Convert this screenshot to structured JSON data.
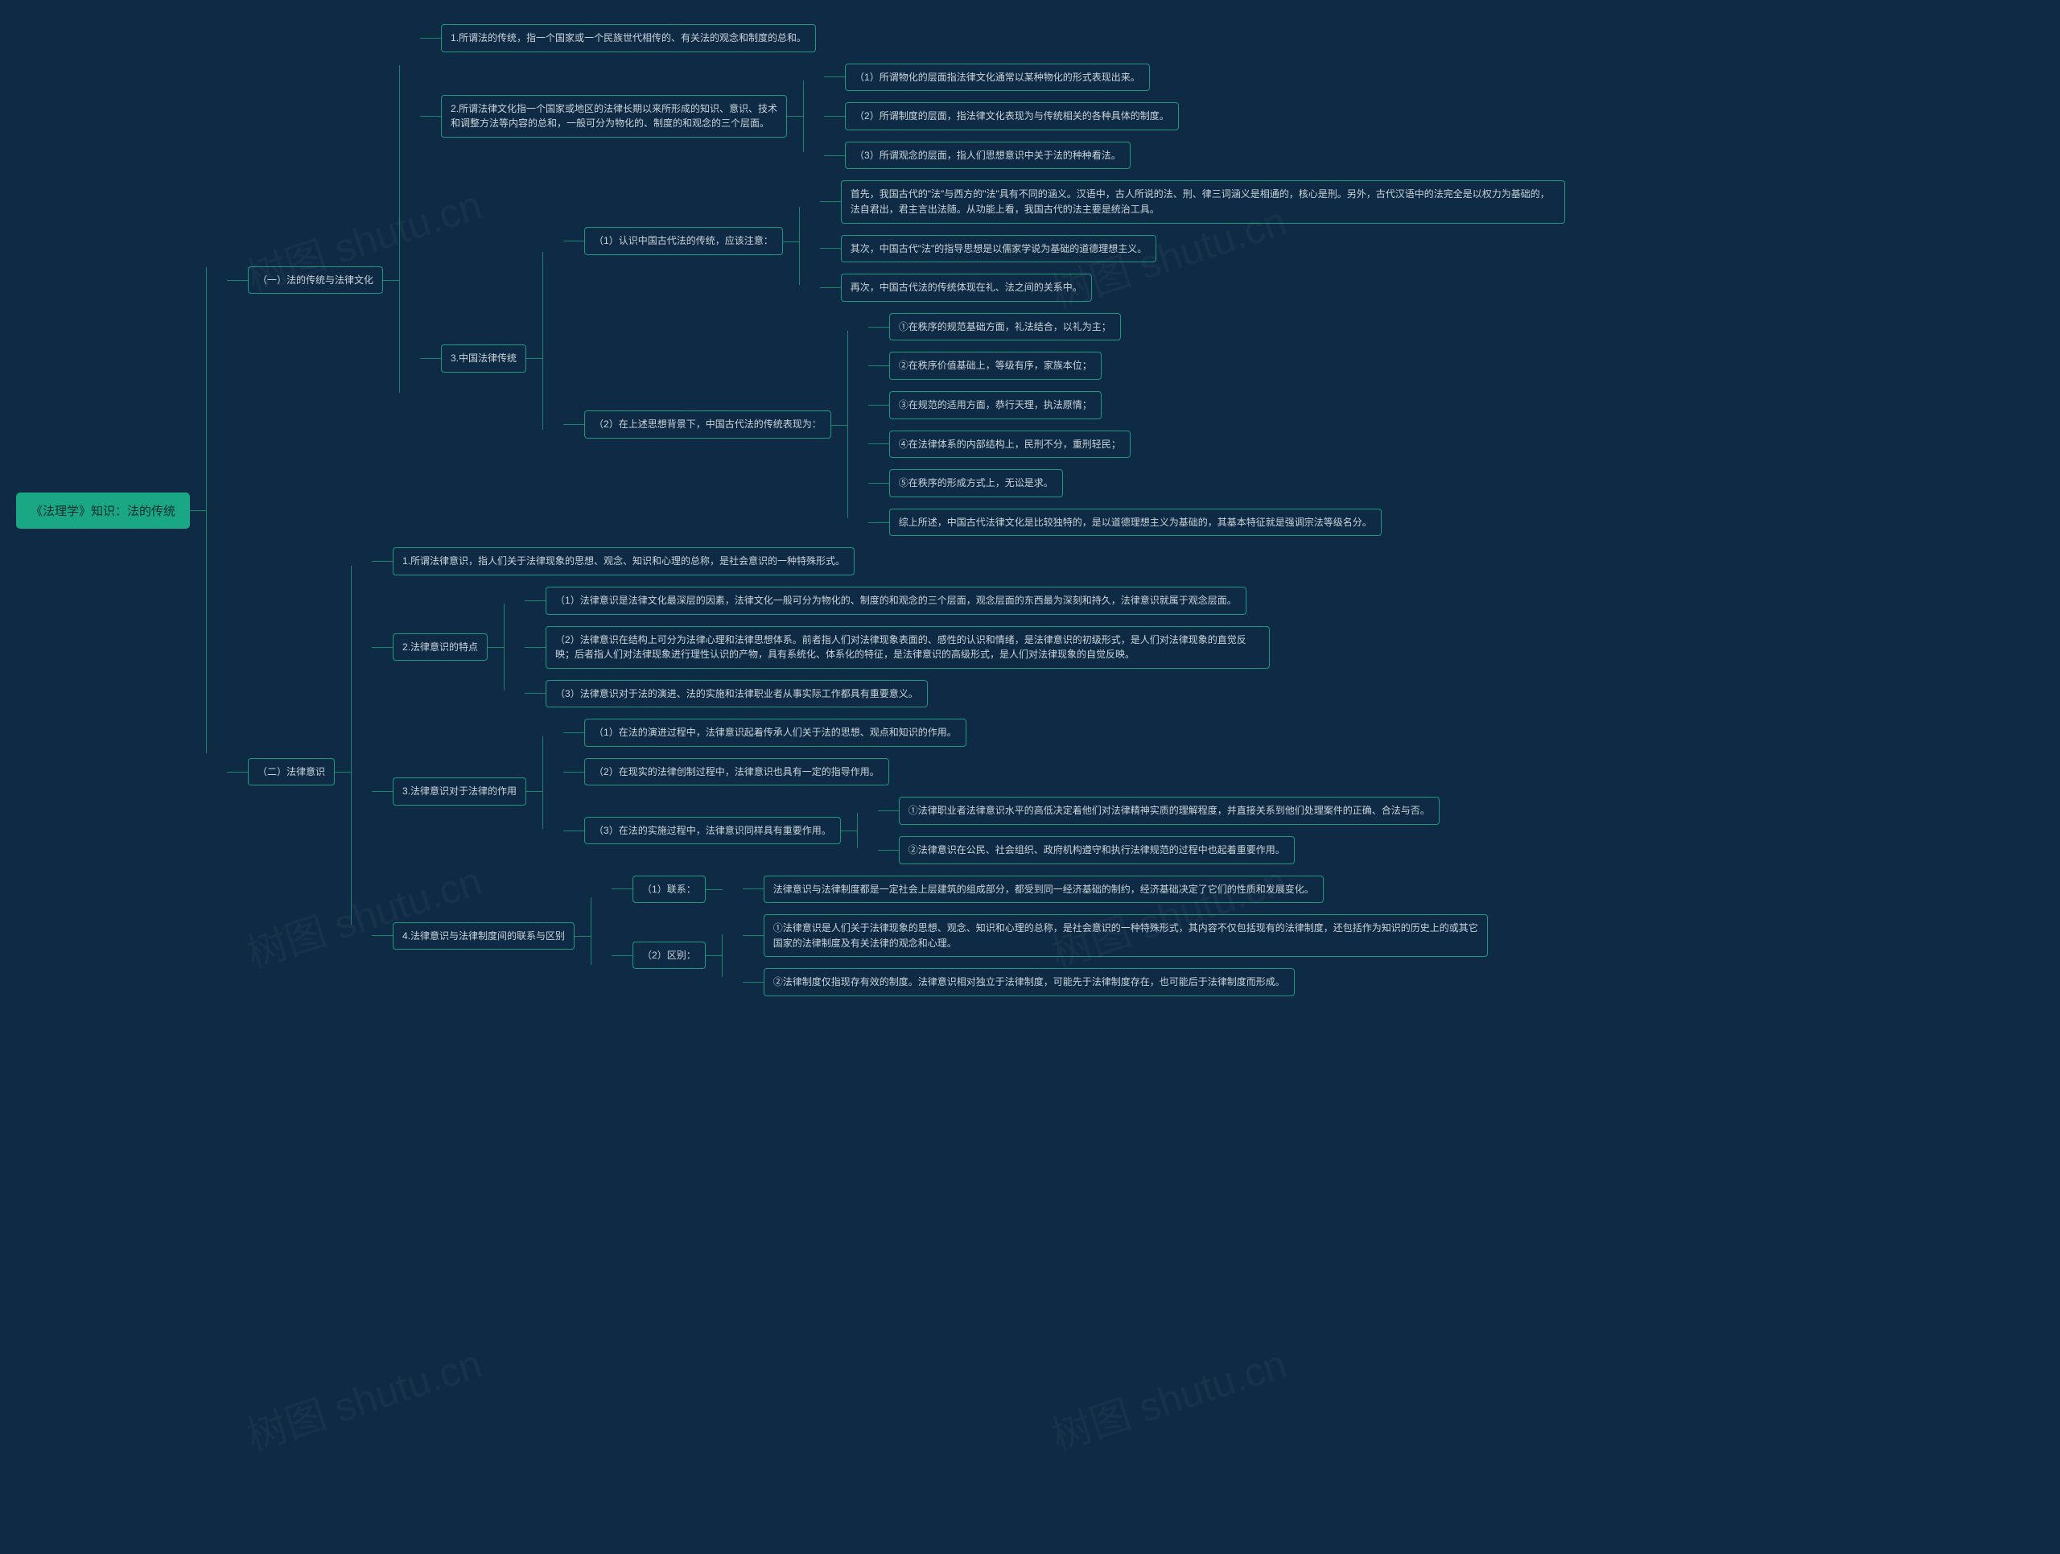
{
  "root": "《法理学》知识：法的传统",
  "s1": {
    "title": "（一）法的传统与法律文化",
    "n1": "1.所谓法的传统，指一个国家或一个民族世代相传的、有关法的观念和制度的总和。",
    "n2": {
      "title": "2.所谓法律文化指一个国家或地区的法律长期以来所形成的知识、意识、技术和调整方法等内容的总和，一般可分为物化的、制度的和观念的三个层面。",
      "c1": "（1）所谓物化的层面指法律文化通常以某种物化的形式表现出来。",
      "c2": "（2）所谓制度的层面，指法律文化表现为与传统相关的各种具体的制度。",
      "c3": "（3）所谓观念的层面，指人们思想意识中关于法的种种看法。"
    },
    "n3": {
      "title": "3.中国法律传统",
      "p1": {
        "title": "（1）认识中国古代法的传统，应该注意：",
        "a": "首先，我国古代的\"法\"与西方的\"法\"具有不同的涵义。汉语中，古人所说的法、刑、律三词涵义是相通的，核心是刑。另外，古代汉语中的法完全是以权力为基础的，法自君出，君主言出法随。从功能上看，我国古代的法主要是统治工具。",
        "b": "其次，中国古代\"法\"的指导思想是以儒家学说为基础的道德理想主义。",
        "c": "再次，中国古代法的传统体现在礼、法之间的关系中。"
      },
      "p2": {
        "title": "（2）在上述思想背景下，中国古代法的传统表现为：",
        "a": "①在秩序的规范基础方面，礼法结合，以礼为主；",
        "b": "②在秩序价值基础上，等级有序，家族本位；",
        "c": "③在规范的适用方面，恭行天理，执法原情；",
        "d": "④在法律体系的内部结构上，民刑不分，重刑轻民；",
        "e": "⑤在秩序的形成方式上，无讼是求。",
        "sum": "综上所述，中国古代法律文化是比较独特的，是以道德理想主义为基础的，其基本特征就是强调宗法等级名分。"
      }
    }
  },
  "s2": {
    "title": "（二）法律意识",
    "n1": "1.所谓法律意识，指人们关于法律现象的思想、观念、知识和心理的总称，是社会意识的一种特殊形式。",
    "n2": {
      "title": "2.法律意识的特点",
      "c1": "（1）法律意识是法律文化最深层的因素，法律文化一般可分为物化的、制度的和观念的三个层面，观念层面的东西最为深刻和持久，法律意识就属于观念层面。",
      "c2": "（2）法律意识在结构上可分为法律心理和法律思想体系。前者指人们对法律现象表面的、感性的认识和情绪，是法律意识的初级形式，是人们对法律现象的直觉反映；后者指人们对法律现象进行理性认识的产物，具有系统化、体系化的特征，是法律意识的高级形式，是人们对法律现象的自觉反映。",
      "c3": "（3）法律意识对于法的演进、法的实施和法律职业者从事实际工作都具有重要意义。"
    },
    "n3": {
      "title": "3.法律意识对于法律的作用",
      "c1": "（1）在法的演进过程中，法律意识起着传承人们关于法的思想、观点和知识的作用。",
      "c2": "（2）在现实的法律创制过程中，法律意识也具有一定的指导作用。",
      "c3": {
        "title": "（3）在法的实施过程中，法律意识同样具有重要作用。",
        "a": "①法律职业者法律意识水平的高低决定着他们对法律精神实质的理解程度，并直接关系到他们处理案件的正确、合法与否。",
        "b": "②法律意识在公民、社会组织、政府机构遵守和执行法律规范的过程中也起着重要作用。"
      }
    },
    "n4": {
      "title": "4.法律意识与法律制度间的联系与区别",
      "lx": {
        "label": "（1）联系：",
        "text": "法律意识与法律制度都是一定社会上层建筑的组成部分，都受到同一经济基础的制约，经济基础决定了它们的性质和发展变化。"
      },
      "qb": {
        "label": "（2）区别：",
        "a": "①法律意识是人们关于法律现象的思想、观念、知识和心理的总称，是社会意识的一种特殊形式，其内容不仅包括现有的法律制度，还包括作为知识的历史上的或其它国家的法律制度及有关法律的观念和心理。",
        "b": "②法律制度仅指现存有效的制度。法律意识相对独立于法律制度，可能先于法律制度存在，也可能后于法律制度而形成。"
      }
    }
  },
  "watermark": "树图 shutu.cn"
}
